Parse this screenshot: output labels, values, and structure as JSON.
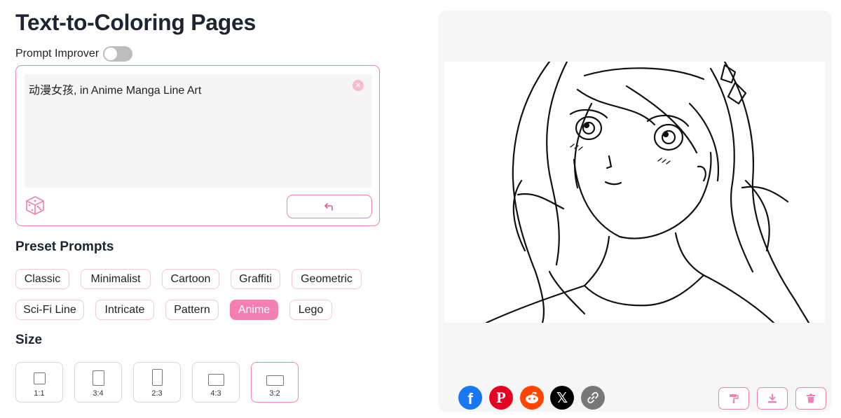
{
  "page": {
    "title": "Text-to-Coloring Pages"
  },
  "improver": {
    "label": "Prompt Improver",
    "enabled": false
  },
  "prompt": {
    "value": "动漫女孩, in Anime Manga Line Art",
    "clear_icon": "close-icon",
    "random_icon": "dice-icon",
    "submit_icon": "return-arrow-icon"
  },
  "presets": {
    "label": "Preset Prompts",
    "items": [
      "Classic",
      "Minimalist",
      "Cartoon",
      "Graffiti",
      "Geometric",
      "Sci-Fi Line",
      "Intricate",
      "Pattern",
      "Anime",
      "Lego"
    ],
    "selected": "Anime"
  },
  "size": {
    "label": "Size",
    "options": [
      "1:1",
      "3:4",
      "2:3",
      "4:3",
      "3:2"
    ],
    "selected": "3:2"
  },
  "share": [
    "facebook-icon",
    "pinterest-icon",
    "reddit-icon",
    "x-icon",
    "link-icon"
  ],
  "actions": [
    "paint-roller-icon",
    "download-icon",
    "trash-icon"
  ],
  "colors": {
    "accent": "#f07fb3",
    "preset_active": "#f47fb2",
    "facebook": "#1877f2",
    "pinterest": "#e60023",
    "reddit": "#ff4500",
    "x": "#000000",
    "link": "#777777"
  }
}
